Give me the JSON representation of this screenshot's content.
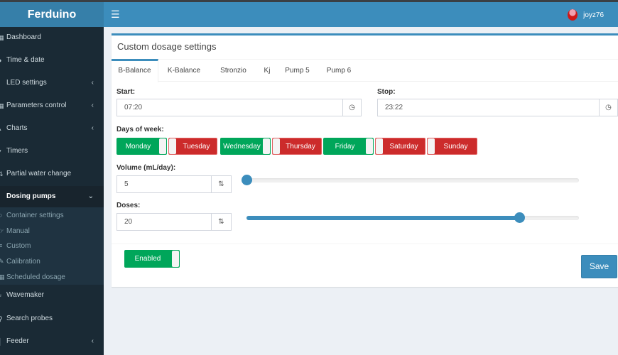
{
  "app": {
    "title": "Ferduino",
    "user": "joyz76",
    "menu_icon": "hamburger-icon"
  },
  "colors": {
    "primary": "#3c8dbc",
    "success": "#00a65a",
    "danger": "#cc2b2b",
    "sidebar": "#1a2a35"
  },
  "sidebar": {
    "items": [
      {
        "label": "Dashboard",
        "icon": "dashboard-icon"
      },
      {
        "label": "Time & date",
        "icon": "clock-icon"
      },
      {
        "label": "LED settings",
        "icon": "lightbulb-icon",
        "chevron": "‹"
      },
      {
        "label": "Parameters control",
        "icon": "table-icon",
        "chevron": "‹"
      },
      {
        "label": "Charts",
        "icon": "chart-icon",
        "chevron": "‹"
      },
      {
        "label": "Timers",
        "icon": "filter-icon"
      },
      {
        "label": "Partial water change",
        "icon": "exchange-icon"
      },
      {
        "label": "Dosing pumps",
        "icon": "eyedropper-icon",
        "chevron": "⌄",
        "active": true
      },
      {
        "label": "Wavemaker",
        "icon": "wave-icon"
      },
      {
        "label": "Search probes",
        "icon": "search-icon"
      },
      {
        "label": "Feeder",
        "icon": "feeder-icon",
        "chevron": "‹"
      }
    ],
    "submenu": [
      {
        "label": "Container settings",
        "icon": "flask-icon"
      },
      {
        "label": "Manual",
        "icon": "hand-icon"
      },
      {
        "label": "Custom",
        "icon": "list-icon"
      },
      {
        "label": "Calibration",
        "icon": "wrench-icon"
      },
      {
        "label": "Scheduled dosage",
        "icon": "calendar-icon"
      }
    ]
  },
  "box": {
    "title": "Custom dosage settings"
  },
  "tabs": [
    "B-Balance",
    "K-Balance",
    "Stronzio",
    "Kj",
    "Pump 5",
    "Pump 6"
  ],
  "active_tab": "B-Balance",
  "form": {
    "start_label": "Start:",
    "start_value": "07:20",
    "stop_label": "Stop:",
    "stop_value": "23:22",
    "days_label": "Days of week:",
    "days": [
      {
        "label": "Monday",
        "on": true
      },
      {
        "label": "Tuesday",
        "on": false
      },
      {
        "label": "Wednesday",
        "on": true
      },
      {
        "label": "Thursday",
        "on": false
      },
      {
        "label": "Friday",
        "on": true
      },
      {
        "label": "Saturday",
        "on": false
      },
      {
        "label": "Sunday",
        "on": false
      }
    ],
    "volume_label": "Volume (mL/day):",
    "volume_value": "5",
    "volume_slider_fraction": 0.0,
    "doses_label": "Doses:",
    "doses_value": "20",
    "doses_slider_fraction": 0.82,
    "enabled_label": "Enabled",
    "enabled": true,
    "save_label": "Save"
  }
}
